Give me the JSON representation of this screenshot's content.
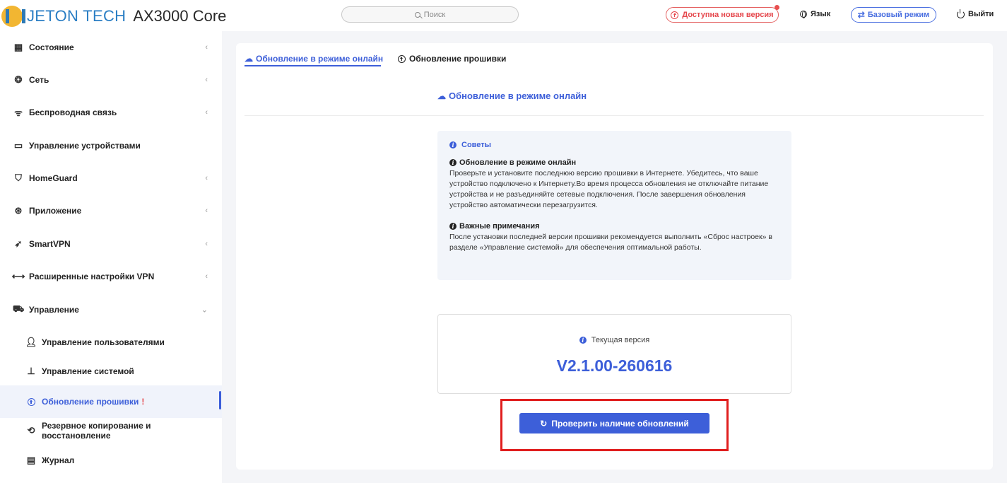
{
  "header": {
    "brand": "JETON TECH",
    "model": "AX3000 Core",
    "search_placeholder": "Поиск",
    "new_version": "Доступна новая версия",
    "language": "Язык",
    "basic_mode": "Базовый режим",
    "logout": "Выйти"
  },
  "sidebar": {
    "items": [
      {
        "label": "Состояние"
      },
      {
        "label": "Сеть"
      },
      {
        "label": "Беспроводная связь"
      },
      {
        "label": "Управление устройствами"
      },
      {
        "label": "HomeGuard"
      },
      {
        "label": "Приложение"
      },
      {
        "label": "SmartVPN"
      },
      {
        "label": "Расширенные настройки VPN"
      },
      {
        "label": "Управление"
      }
    ],
    "sub_items": [
      {
        "label": "Управление пользователями"
      },
      {
        "label": "Управление системой"
      },
      {
        "label": "Обновление прошивки",
        "badge": "!"
      },
      {
        "label": "Резервное копирование и восстановление"
      },
      {
        "label": "Журнал"
      }
    ]
  },
  "main": {
    "tabs": [
      {
        "label": "Обновление в режиме онлайн"
      },
      {
        "label": "Обновление прошивки"
      }
    ],
    "section_title": "Обновление в режиме онлайн",
    "tips": {
      "heading": "Советы",
      "blocks": [
        {
          "title": "Обновление в режиме онлайн",
          "text": "Проверьте и установите последнюю версию прошивки в Интернете. Убедитесь, что ваше устройство подключено к Интернету.Во время процесса обновления не отключайте питание устройства и не разъединяйте сетевые подключения. После завершения обновления устройство автоматически перезагрузится."
        },
        {
          "title": "Важные примечания",
          "text": "После установки последней версии прошивки рекомендуется выполнить «Сброс настроек» в разделе «Управление системой» для обеспечения оптимальной работы."
        }
      ]
    },
    "current_version_label": "Текущая версия",
    "current_version": "V2.1.00-260616",
    "check_button": "Проверить наличие обновлений"
  },
  "colors": {
    "accent": "#3d5fd9",
    "alert": "#e5484d",
    "highlight_box": "#e01e1e"
  }
}
